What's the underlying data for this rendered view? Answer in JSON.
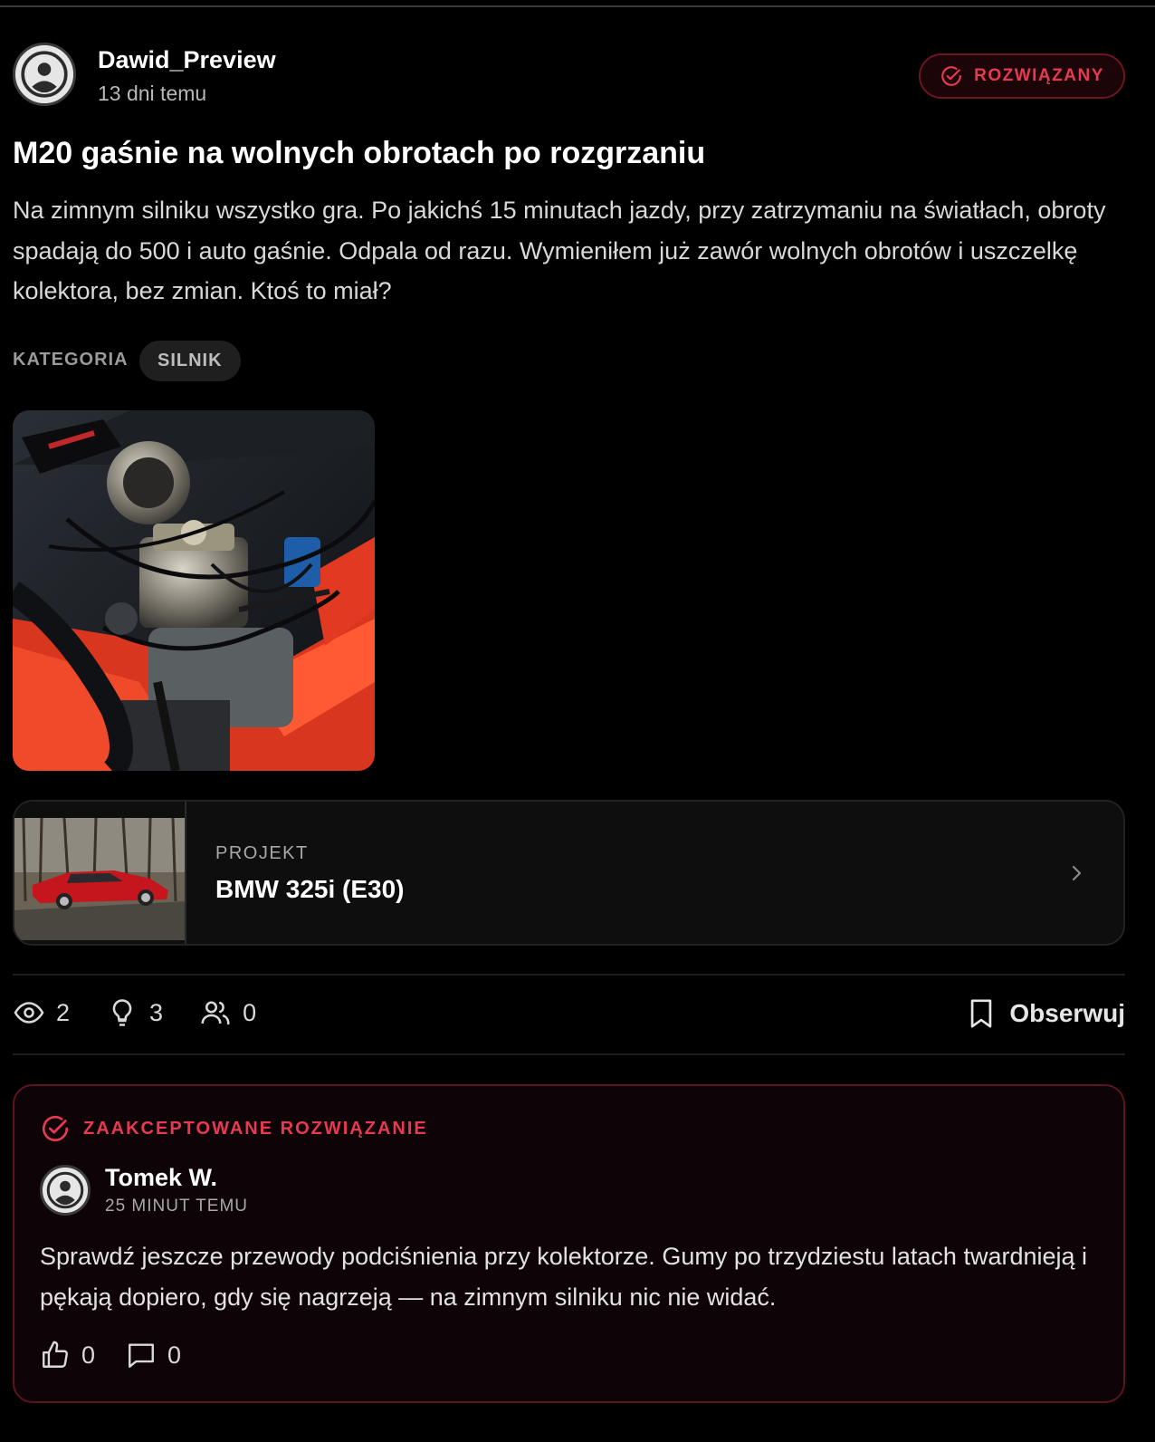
{
  "post": {
    "author": {
      "name": "Dawid_Preview",
      "time": "13 dni temu"
    },
    "status_badge": "ROZWIĄZANY",
    "title": "M20 gaśnie na wolnych obrotach po rozgrzaniu",
    "body": "Na zimnym silniku wszystko gra. Po jakichś 15 minutach jazdy, przy zatrzymaniu na światłach, obroty spadają do 500 i auto gaśnie. Odpala od razu. Wymieniłem już zawór wolnych obrotów i uszczelkę kolektora, bez zmian. Ktoś to miał?",
    "category_label": "KATEGORIA",
    "category": "SILNIK"
  },
  "project": {
    "kicker": "PROJEKT",
    "name": "BMW 325i (E30)"
  },
  "stats": {
    "views": "2",
    "ideas": "3",
    "participants": "0",
    "follow_label": "Obserwuj"
  },
  "answer": {
    "header": "ZAAKCEPTOWANE ROZWIĄZANIE",
    "author": "Tomek W.",
    "time": "25 MINUT TEMU",
    "body": "Sprawdź jeszcze przewody podciśnienia przy kolektorze. Gumy po trzydziestu latach twardnieją i pękają dopiero, gdy się nagrzeją — na zimnym silniku nic nie widać.",
    "likes": "0",
    "comments": "0"
  },
  "colors": {
    "accent": "#e63a52",
    "background": "#000000",
    "card": "#0e0e0e"
  },
  "icons": [
    "user-avatar-icon",
    "check-circle-icon",
    "eye-icon",
    "lightbulb-icon",
    "users-icon",
    "bookmark-icon",
    "chevron-right-icon",
    "thumbs-up-icon",
    "comment-icon"
  ]
}
